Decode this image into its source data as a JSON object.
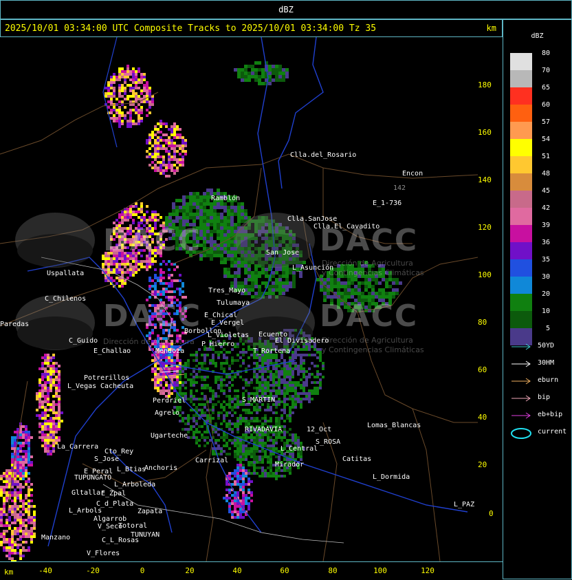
{
  "header": {
    "title": "dBZ"
  },
  "title_bar": {
    "text": "2025/10/01 03:34:00 UTC Composite Tracks to 2025/10/01 03:34:00 Tz 35",
    "unit": "km"
  },
  "axes": {
    "unit_label": "km",
    "x_ticks": [
      "-40",
      "-20",
      "0",
      "20",
      "40",
      "60",
      "80",
      "100",
      "120"
    ],
    "y_ticks": [
      "180",
      "160",
      "140",
      "120",
      "100",
      "80",
      "60",
      "40",
      "20",
      "0"
    ]
  },
  "legend": {
    "title": "dBZ",
    "scale": [
      {
        "label": "80",
        "color": "#e0e0e0"
      },
      {
        "label": "70",
        "color": "#b8b8b8"
      },
      {
        "label": "65",
        "color": "#ff3020"
      },
      {
        "label": "60",
        "color": "#ff6010"
      },
      {
        "label": "57",
        "color": "#ff9a50"
      },
      {
        "label": "54",
        "color": "#ffff00"
      },
      {
        "label": "51",
        "color": "#ffc830"
      },
      {
        "label": "48",
        "color": "#d88c3c"
      },
      {
        "label": "45",
        "color": "#c86a8a"
      },
      {
        "label": "42",
        "color": "#e06aa0"
      },
      {
        "label": "39",
        "color": "#c810a0"
      },
      {
        "label": "36",
        "color": "#7010c8"
      },
      {
        "label": "35",
        "color": "#2050e0"
      },
      {
        "label": "30",
        "color": "#1088d8"
      },
      {
        "label": "20",
        "color": "#108010"
      },
      {
        "label": "10",
        "color": "#0c5a0c"
      },
      {
        "label": "5",
        "color": "#4a3a8a"
      }
    ],
    "tracks": [
      {
        "label": "50YD",
        "color": "#40c8d0"
      },
      {
        "label": "30HM",
        "color": "#ffffff"
      },
      {
        "label": "eburn",
        "color": "#f0b060"
      },
      {
        "label": "bip",
        "color": "#f0a8b8"
      },
      {
        "label": "eb+bip",
        "color": "#e040e0"
      },
      {
        "label": "current",
        "color": "#20e0f0"
      }
    ]
  },
  "places": [
    {
      "name": "Clla.del_Rosario"
    },
    {
      "name": "Encon"
    },
    {
      "name": "142"
    },
    {
      "name": "E_1-736"
    },
    {
      "name": "Ramblón"
    },
    {
      "name": "Clla.SanJose"
    },
    {
      "name": "Clla.El_Cavadito"
    },
    {
      "name": "Uspallata"
    },
    {
      "name": "San Jose"
    },
    {
      "name": "L_Asunción"
    },
    {
      "name": "Tres_Mayo"
    },
    {
      "name": "Tulumaya"
    },
    {
      "name": "C_Chilenos"
    },
    {
      "name": "E_Chical"
    },
    {
      "name": "E_Vergel"
    },
    {
      "name": "Borbollon"
    },
    {
      "name": "L_Violetas"
    },
    {
      "name": "P_Hierro"
    },
    {
      "name": "Ecuento"
    },
    {
      "name": "El Divisadero"
    },
    {
      "name": "C_Guido"
    },
    {
      "name": "E_Challao"
    },
    {
      "name": "Mendoza"
    },
    {
      "name": "T_Rortena"
    },
    {
      "name": "Paredas"
    },
    {
      "name": "Potrerillos"
    },
    {
      "name": "L_Vegas"
    },
    {
      "name": "Cacheuta"
    },
    {
      "name": "Perdriel"
    },
    {
      "name": "Agrelo"
    },
    {
      "name": "S_MARTIN"
    },
    {
      "name": "RIVADAVIA"
    },
    {
      "name": "Ugarteche"
    },
    {
      "name": "Lomas_Blancas"
    },
    {
      "name": "12_Oct"
    },
    {
      "name": "S_ROSA"
    },
    {
      "name": "L_Central"
    },
    {
      "name": "La_Carrera"
    },
    {
      "name": "Cto_Rey"
    },
    {
      "name": "S_Jose"
    },
    {
      "name": "Anchoris"
    },
    {
      "name": "Carrizal"
    },
    {
      "name": "Catitas"
    },
    {
      "name": "Mirador"
    },
    {
      "name": "E_Peral"
    },
    {
      "name": "TUPUNGATO"
    },
    {
      "name": "L_Btias"
    },
    {
      "name": "L_Arboleda"
    },
    {
      "name": "L_Dormida"
    },
    {
      "name": "Gltallar"
    },
    {
      "name": "E_Zpal"
    },
    {
      "name": "L_Arbols"
    },
    {
      "name": "C_d_Plata"
    },
    {
      "name": "Zapata"
    },
    {
      "name": "Algarrob"
    },
    {
      "name": "V_Seco"
    },
    {
      "name": "Totoral"
    },
    {
      "name": "TUNUYAN"
    },
    {
      "name": "Manzano"
    },
    {
      "name": "C_L_Rosas"
    },
    {
      "name": "V_Flores"
    },
    {
      "name": "L_PAZ"
    }
  ],
  "watermarks": [
    {
      "name": "DACC",
      "line1": "Dirección de Agricultura",
      "line2": "y Contingencias Climáticas"
    }
  ]
}
